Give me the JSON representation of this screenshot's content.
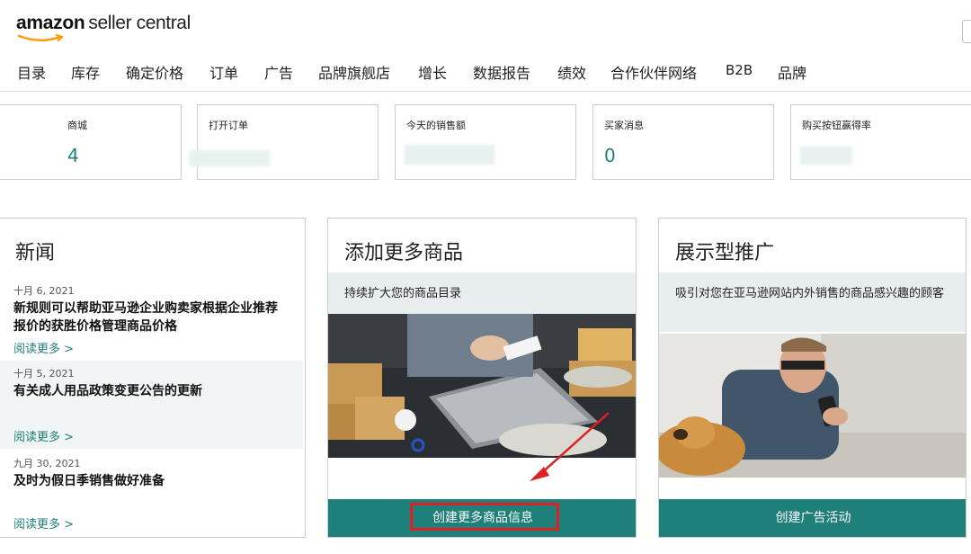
{
  "header": {
    "logo_amazon": "amazon",
    "logo_seller_central": "seller central"
  },
  "nav": [
    {
      "label": "目录"
    },
    {
      "label": "库存"
    },
    {
      "label": "确定价格"
    },
    {
      "label": "订单"
    },
    {
      "label": "广告"
    },
    {
      "label": "品牌旗舰店"
    },
    {
      "label": "增长"
    },
    {
      "label": "数据报告"
    },
    {
      "label": "绩效"
    },
    {
      "label": "合作伙伴网络"
    },
    {
      "label": "B2B"
    },
    {
      "label": "品牌"
    }
  ],
  "metrics": [
    {
      "label": "商城",
      "value": "4"
    },
    {
      "label": "打开订单",
      "value": ""
    },
    {
      "label": "今天的销售额",
      "value": ""
    },
    {
      "label": "买家消息",
      "value": "0"
    },
    {
      "label": "购买按钮赢得率",
      "value": ""
    }
  ],
  "news": {
    "title": "新闻",
    "items": [
      {
        "date": "十月 6, 2021",
        "headline": "新规则可以帮助亚马逊企业购卖家根据企业推荐报价的获胜价格管理商品价格",
        "more": "阅读更多 >"
      },
      {
        "date": "十月 5, 2021",
        "headline": "有关成人用品政策变更公告的更新",
        "more": "阅读更多 >"
      },
      {
        "date": "九月 30, 2021",
        "headline": "及时为假日季销售做好准备",
        "more": "阅读更多 >"
      }
    ]
  },
  "add_products": {
    "title": "添加更多商品",
    "subtitle": "持续扩大您的商品目录",
    "cta": "创建更多商品信息"
  },
  "display_ads": {
    "title": "展示型推广",
    "subtitle": "吸引对您在亚马逊网站内外销售的商品感兴趣的顾客",
    "cta": "创建广告活动"
  },
  "colors": {
    "accent": "#1f7f7a",
    "highlight": "#e02020",
    "band": "#e8edee"
  }
}
